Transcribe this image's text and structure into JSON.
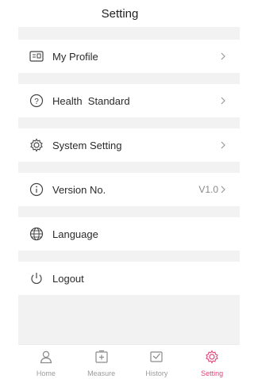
{
  "header": {
    "title": "Setting"
  },
  "menu": [
    {
      "label": "My Profile",
      "value": "",
      "icon": "profile-card-icon",
      "chevron": true
    },
    {
      "label": "Health  Standard",
      "value": "",
      "icon": "question-circle-icon",
      "chevron": true
    },
    {
      "label": "System Setting",
      "value": "",
      "icon": "gear-icon",
      "chevron": true
    },
    {
      "label": "Version No.",
      "value": "V1.0",
      "icon": "info-circle-icon",
      "chevron": true
    },
    {
      "label": "Language",
      "value": "",
      "icon": "globe-icon",
      "chevron": false
    },
    {
      "label": "Logout",
      "value": "",
      "icon": "power-icon",
      "chevron": false
    }
  ],
  "tabs": [
    {
      "label": "Home",
      "icon": "person-icon",
      "active": false
    },
    {
      "label": "Measure",
      "icon": "plus-box-icon",
      "active": false
    },
    {
      "label": "History",
      "icon": "checkbox-icon",
      "active": false
    },
    {
      "label": "Setting",
      "icon": "gear-icon",
      "active": true
    }
  ],
  "colors": {
    "accent": "#e0457a",
    "inactive": "#9a9a9a",
    "background": "#f2f2f2"
  }
}
